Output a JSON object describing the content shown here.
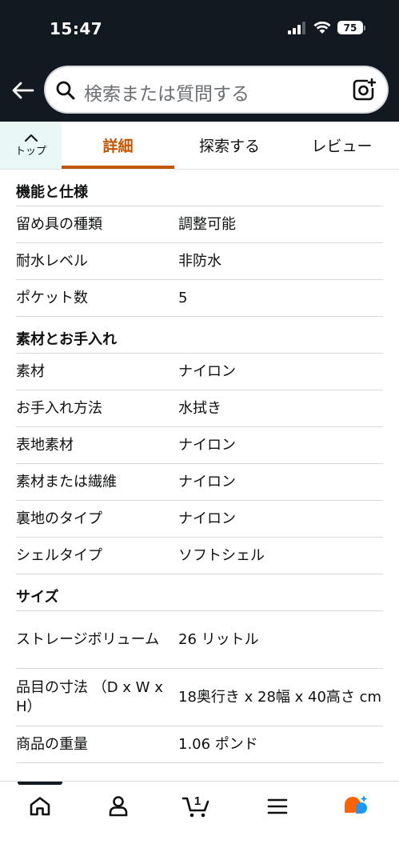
{
  "status_bar": {
    "time": "15:47",
    "battery": "75"
  },
  "search": {
    "placeholder": "検索または質問する"
  },
  "tabs": {
    "top_label": "トップ",
    "items": [
      "詳細",
      "探索する",
      "レビュー"
    ],
    "active": "詳細"
  },
  "sections": [
    {
      "title": "機能と仕様",
      "rows": [
        {
          "key": "留め具の種類",
          "value": "調整可能"
        },
        {
          "key": "耐水レベル",
          "value": "非防水"
        },
        {
          "key": "ポケット数",
          "value": "5"
        }
      ]
    },
    {
      "title": "素材とお手入れ",
      "rows": [
        {
          "key": "素材",
          "value": "ナイロン"
        },
        {
          "key": "お手入れ方法",
          "value": "水拭き"
        },
        {
          "key": "表地素材",
          "value": "ナイロン"
        },
        {
          "key": "素材または繊維",
          "value": "ナイロン"
        },
        {
          "key": "裏地のタイプ",
          "value": "ナイロン"
        },
        {
          "key": "シェルタイプ",
          "value": "ソフトシェル"
        }
      ]
    },
    {
      "title": "サイズ",
      "rows": [
        {
          "key": "ストレージボリューム",
          "value": "26 リットル"
        },
        {
          "key": "品目の寸法 （D x W x H）",
          "value": "18奥行き x 28幅 x 40高さ cm"
        },
        {
          "key": "商品の重量",
          "value": "1.06 ポンド"
        }
      ]
    }
  ],
  "bottom_nav": {
    "items": [
      "home-icon",
      "account-icon",
      "cart-icon",
      "menu-icon",
      "rufus-icon"
    ],
    "cart_count": "1"
  },
  "colors": {
    "header_bg": "#131921",
    "accent": "#c45500",
    "tab_top_bg": "#e9f7f6",
    "rufus_orange": "#ff6200",
    "rufus_blue": "#1a98ff"
  }
}
